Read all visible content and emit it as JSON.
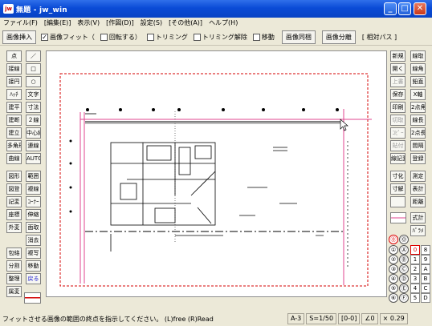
{
  "window": {
    "title": "無題 - jw_win",
    "app_icon": "jw"
  },
  "menu": [
    "ファイル(F)",
    "[編集(E)]",
    "表示(V)",
    "[作図(D)]",
    "設定(S)",
    "[その他(A)]",
    "ヘルプ(H)"
  ],
  "toolbar": {
    "insert_btn": "画像挿入",
    "fit_check": "✓",
    "fit_label": "画像フィット（",
    "rotate_label": "回転する）",
    "trim_label": "トリミング",
    "trim_release_label": "トリミング解除",
    "move_label": "移動",
    "same_btn": "画像同梱",
    "split_btn": "画像分離",
    "relpath_label": "[ 相対パス ]"
  },
  "left_tools": [
    "点",
    "／",
    "接線",
    "□",
    "接円",
    "○",
    "ﾊｯﾁ",
    "文字",
    "建平",
    "寸法",
    "建断",
    "２線",
    "建立",
    "中心線",
    "多角形",
    "連線",
    "曲線",
    "AUTO",
    "図形",
    "範囲",
    "図登",
    "複線",
    "記変",
    "ｺｰﾅｰ",
    "座標",
    "伸縮",
    "外変",
    "面取",
    "",
    "消去",
    "包絡",
    "複写",
    "分割",
    "移動",
    "整理",
    "戻る",
    "属変"
  ],
  "right_tools": [
    "新規",
    "開く",
    "上書",
    "保存",
    "印刷",
    "切取",
    "ｺﾋﾟｰ",
    "貼付",
    "線記変",
    "寸化",
    "寸解",
    "",
    ""
  ],
  "right_tools2": [
    "線取",
    "線角",
    "鉛直",
    "X軸",
    "2点角",
    "線長",
    "2点長",
    "間隔",
    "登録",
    "測定",
    "表計",
    "距離",
    "式計",
    "ﾊﾟﾗﾒ"
  ],
  "circles": [
    "①",
    "②",
    "③",
    "④",
    "⑤",
    "⑥",
    "Ⓐ",
    "Ⓑ",
    "Ⓒ",
    "Ⓓ",
    "Ⓔ",
    "Ⓕ"
  ],
  "circle_top": "⓪",
  "circle_top2": "Ⓞ",
  "num_grid": [
    "0",
    "8",
    "1",
    "9",
    "2",
    "A",
    "3",
    "B",
    "4",
    "C",
    "5",
    "D"
  ],
  "status": {
    "message": "フィットさせる画像の範囲の終点を指示してください。 (L)free (R)Read",
    "paper": "A-3",
    "scale": "S=1/50",
    "layer": "[0-0]",
    "angle": "∠0",
    "zoom": "× 0.29"
  },
  "colors": {
    "titlebar": "#0a4bd6",
    "canvas_bg": "#ffffff",
    "frame_red": "#d40000",
    "pink_line": "#e0448f"
  }
}
